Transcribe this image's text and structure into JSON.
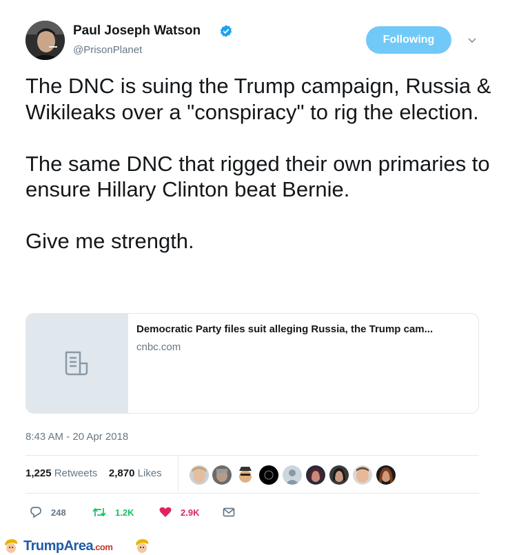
{
  "author": {
    "name": "Paul Joseph Watson",
    "handle": "@PrisonPlanet"
  },
  "follow_button": {
    "label": "Following"
  },
  "tweet": {
    "paragraphs": [
      "The DNC is suing the Trump campaign, Russia & Wikileaks over a \"conspiracy\" to rig the election.",
      "The same DNC that rigged their own primaries to ensure Hillary Clinton beat Bernie.",
      "Give me strength."
    ]
  },
  "link_card": {
    "title": "Democratic Party files suit alleging Russia, the Trump cam...",
    "domain": "cnbc.com"
  },
  "timestamp": "8:43 AM - 20 Apr 2018",
  "stats": {
    "retweets_count": "1,225",
    "retweets_label": "Retweets",
    "likes_count": "2,870",
    "likes_label": "Likes"
  },
  "actions": {
    "reply_count": "248",
    "retweet_count": "1.2K",
    "like_count": "2.9K"
  },
  "watermark": {
    "brand": "TrumpArea",
    "suffix": ".com"
  },
  "colors": {
    "accent": "#71c9f8",
    "verified": "#1da1f2",
    "retweet_green": "#17bf63",
    "like_red": "#e0245e",
    "muted": "#657786"
  },
  "icons": [
    "verified-badge-icon",
    "chevron-down-icon",
    "document-icon",
    "reply-icon",
    "retweet-icon",
    "heart-icon",
    "message-icon"
  ]
}
